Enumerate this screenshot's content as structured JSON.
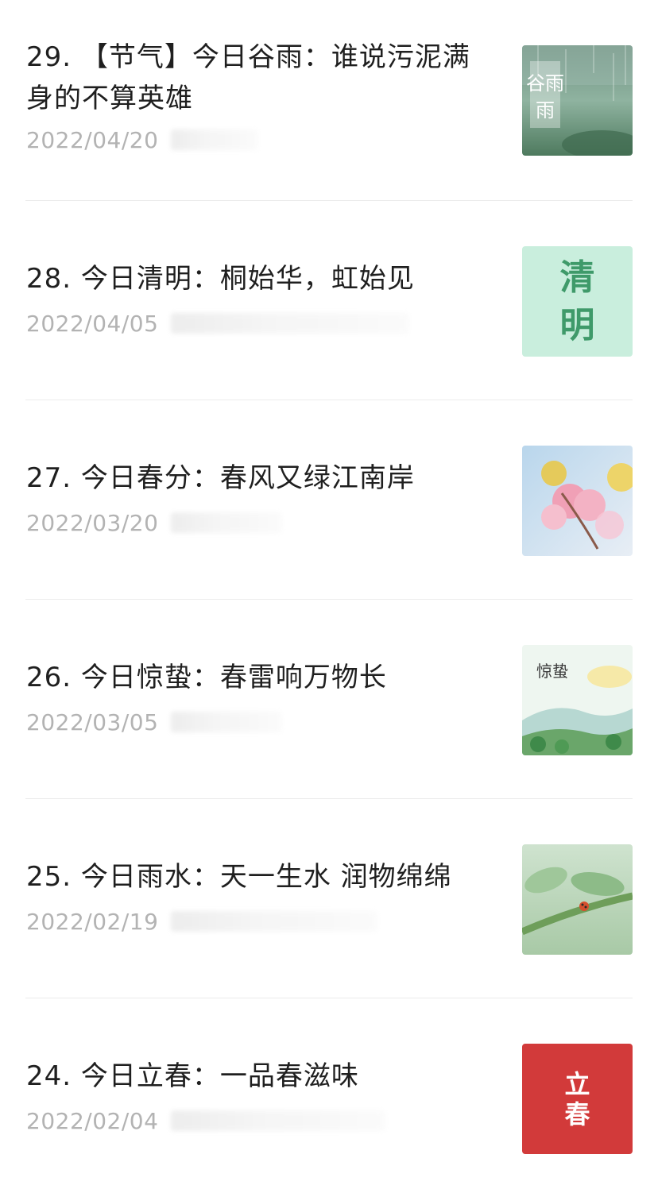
{
  "articles": [
    {
      "title": "29. 【节气】今日谷雨：谁说污泥满身的不算英雄",
      "date": "2022/04/20",
      "thumb_text": "谷雨",
      "thumb_icon": "guyu-rain-thumbnail"
    },
    {
      "title": "28. 今日清明：桐始华，虹始见",
      "date": "2022/04/05",
      "thumb_text": "清明",
      "thumb_icon": "qingming-thumbnail"
    },
    {
      "title": "27. 今日春分：春风又绿江南岸",
      "date": "2022/03/20",
      "thumb_text": "",
      "thumb_icon": "blossom-thumbnail"
    },
    {
      "title": "26. 今日惊蛰：春雷响万物长",
      "date": "2022/03/05",
      "thumb_text": "惊蛰",
      "thumb_icon": "jingzhe-thumbnail"
    },
    {
      "title": "25. 今日雨水：天一生水 润物绵绵",
      "date": "2022/02/19",
      "thumb_text": "",
      "thumb_icon": "ladybug-branch-thumbnail"
    },
    {
      "title": "24. 今日立春：一品春滋味",
      "date": "2022/02/04",
      "thumb_text": "立春",
      "thumb_icon": "lichun-thumbnail"
    }
  ],
  "colors": {
    "title": "#1f1f1f",
    "date": "#b3b3b3",
    "divider": "#ebebeb",
    "qingming_bg": "#c9eedd",
    "qingming_text": "#3f9a6a",
    "lichun_bg": "#d23a3a"
  }
}
